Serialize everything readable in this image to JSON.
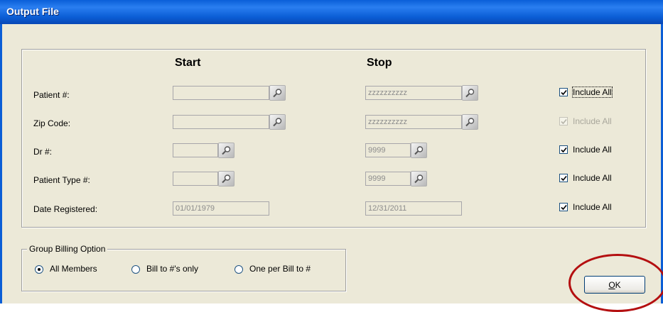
{
  "window": {
    "title": "Output File"
  },
  "columns": {
    "start": "Start",
    "stop": "Stop"
  },
  "rows": [
    {
      "label": "Patient #:",
      "start_value": "",
      "stop_value": "zzzzzzzzzz",
      "include_all_label": "Include All",
      "include_all_checked": true,
      "include_all_enabled": true,
      "has_lookup": true
    },
    {
      "label": "Zip Code:",
      "start_value": "",
      "stop_value": "zzzzzzzzzz",
      "include_all_label": "Include All",
      "include_all_checked": true,
      "include_all_enabled": false,
      "has_lookup": true
    },
    {
      "label": "Dr #:",
      "start_value": "",
      "stop_value": "9999",
      "include_all_label": "Include All",
      "include_all_checked": true,
      "include_all_enabled": true,
      "has_lookup": true
    },
    {
      "label": "Patient Type #:",
      "start_value": "",
      "stop_value": "9999",
      "include_all_label": "Include All",
      "include_all_checked": true,
      "include_all_enabled": true,
      "has_lookup": true
    },
    {
      "label": "Date Registered:",
      "start_value": "01/01/1979",
      "stop_value": "12/31/2011",
      "include_all_label": "Include All",
      "include_all_checked": true,
      "include_all_enabled": true,
      "has_lookup": false
    }
  ],
  "group_billing": {
    "legend": "Group Billing Option",
    "options": [
      {
        "label": "All Members",
        "selected": true
      },
      {
        "label": "Bill to #'s only",
        "selected": false
      },
      {
        "label": "One per Bill to #",
        "selected": false
      }
    ]
  },
  "ok_button": {
    "label": "OK",
    "accel": "O",
    "rest": "K"
  },
  "icons": {
    "lookup": "magnifier-icon",
    "check": "checkmark-icon"
  },
  "colors": {
    "title_bar": "#0b5ed6",
    "dialog_bg": "#ece9d8",
    "highlight_ring": "#b40f10"
  }
}
